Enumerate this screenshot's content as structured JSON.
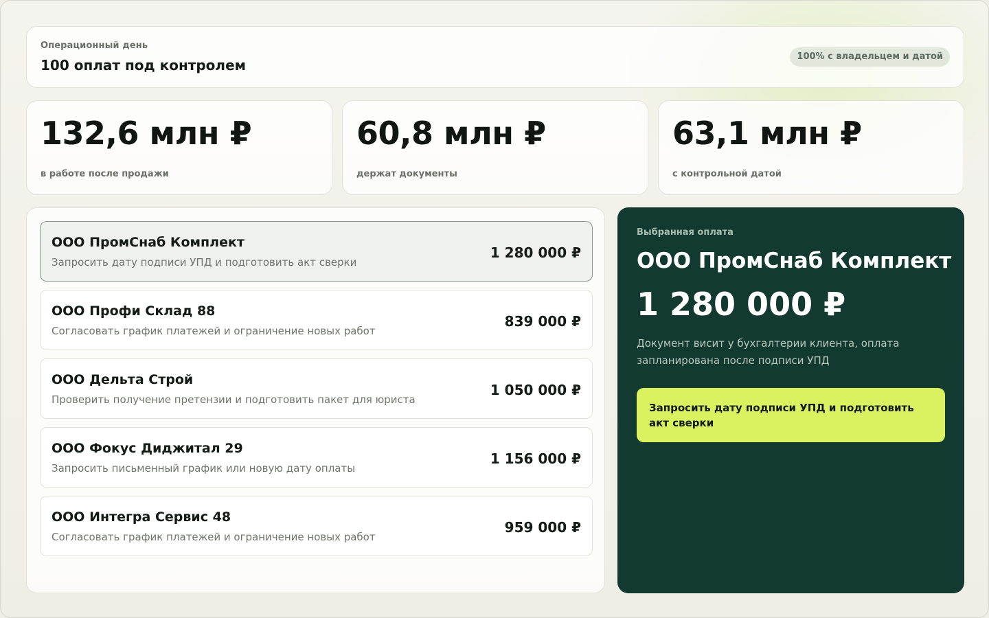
{
  "header": {
    "eyebrow": "Операционный день",
    "title": "100 оплат под контролем",
    "badge": "100% с владельцем и датой"
  },
  "stats": [
    {
      "value": "132,6 млн ₽",
      "label": "в работе после продажи"
    },
    {
      "value": "60,8 млн ₽",
      "label": "держат документы"
    },
    {
      "value": "63,1 млн ₽",
      "label": "с контрольной датой"
    }
  ],
  "payments": [
    {
      "name": "ООО ПромСнаб Комплект",
      "action": "Запросить дату подписи УПД и подготовить акт сверки",
      "amount": "1 280 000 ₽",
      "selected": true
    },
    {
      "name": "ООО Профи Склад 88",
      "action": "Согласовать график платежей и ограничение новых работ",
      "amount": "839 000 ₽",
      "selected": false
    },
    {
      "name": "ООО Дельта Строй",
      "action": "Проверить получение претензии и подготовить пакет для юриста",
      "amount": "1 050 000 ₽",
      "selected": false
    },
    {
      "name": "ООО Фокус Диджитал 29",
      "action": "Запросить письменный график или новую дату оплаты",
      "amount": "1 156 000 ₽",
      "selected": false
    },
    {
      "name": "ООО Интегра Сервис 48",
      "action": "Согласовать график платежей и ограничение новых работ",
      "amount": "959 000 ₽",
      "selected": false
    }
  ],
  "detail": {
    "eyebrow": "Выбранная оплата",
    "company": "ООО ПромСнаб Комплект",
    "amount": "1 280 000 ₽",
    "note": "Документ висит у бухгалтерии клиента, оплата запланирована после подписи УПД",
    "action_label": "Запросить дату подписи УПД и подготовить акт сверки"
  },
  "colors": {
    "accent": "#daf260",
    "panel_dark": "#133a30",
    "badge_bg": "#e2e7dc"
  }
}
